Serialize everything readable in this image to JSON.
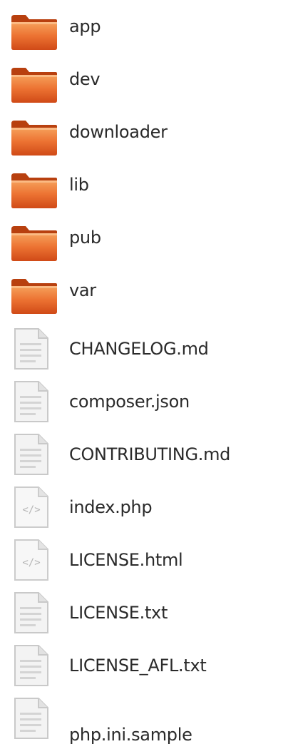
{
  "file_list": {
    "items": [
      {
        "name": "app",
        "type": "folder",
        "icon": "folder-icon"
      },
      {
        "name": "dev",
        "type": "folder",
        "icon": "folder-icon"
      },
      {
        "name": "downloader",
        "type": "folder",
        "icon": "folder-icon"
      },
      {
        "name": "lib",
        "type": "folder",
        "icon": "folder-icon"
      },
      {
        "name": "pub",
        "type": "folder",
        "icon": "folder-icon"
      },
      {
        "name": "var",
        "type": "folder",
        "icon": "folder-icon"
      },
      {
        "name": "CHANGELOG.md",
        "type": "text",
        "icon": "text-file-icon"
      },
      {
        "name": "composer.json",
        "type": "text",
        "icon": "text-file-icon"
      },
      {
        "name": "CONTRIBUTING.md",
        "type": "text",
        "icon": "text-file-icon"
      },
      {
        "name": "index.php",
        "type": "code",
        "icon": "code-file-icon"
      },
      {
        "name": "LICENSE.html",
        "type": "code",
        "icon": "code-file-icon"
      },
      {
        "name": "LICENSE.txt",
        "type": "text",
        "icon": "text-file-icon"
      },
      {
        "name": "LICENSE_AFL.txt",
        "type": "text",
        "icon": "text-file-icon"
      },
      {
        "name": "php.ini.sample",
        "type": "text",
        "icon": "text-file-icon"
      }
    ]
  },
  "colors": {
    "folder_light": "#f28a3c",
    "folder_dark": "#d9541a",
    "folder_tab": "#b8400f",
    "file_paper": "#f3f3f3",
    "file_border": "#c9c9c9",
    "text": "#2a2a2a"
  }
}
